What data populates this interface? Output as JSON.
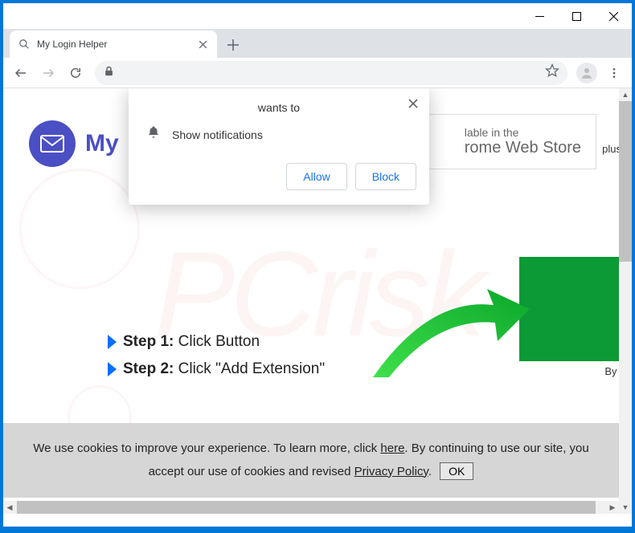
{
  "tab": {
    "title": "My Login Helper"
  },
  "page": {
    "logo_text": "My",
    "store_line1": "lable in the",
    "store_line2": "rome Web Store",
    "plus_text": "plus w",
    "byline": "By In",
    "steps": [
      {
        "label": "Step 1:",
        "text": " Click Button"
      },
      {
        "label": "Step 2:",
        "text": " Click \"Add Extension\""
      }
    ]
  },
  "notification": {
    "header": "wants to",
    "message": "Show notifications",
    "allow": "Allow",
    "block": "Block"
  },
  "cookies": {
    "text1": "We use cookies to improve your experience. To learn more, click ",
    "here": "here",
    "text2": ". By continuing to use our site, you accept our use of cookies and revised ",
    "privacy": "Privacy Policy",
    "dot": ".",
    "ok": "OK"
  }
}
